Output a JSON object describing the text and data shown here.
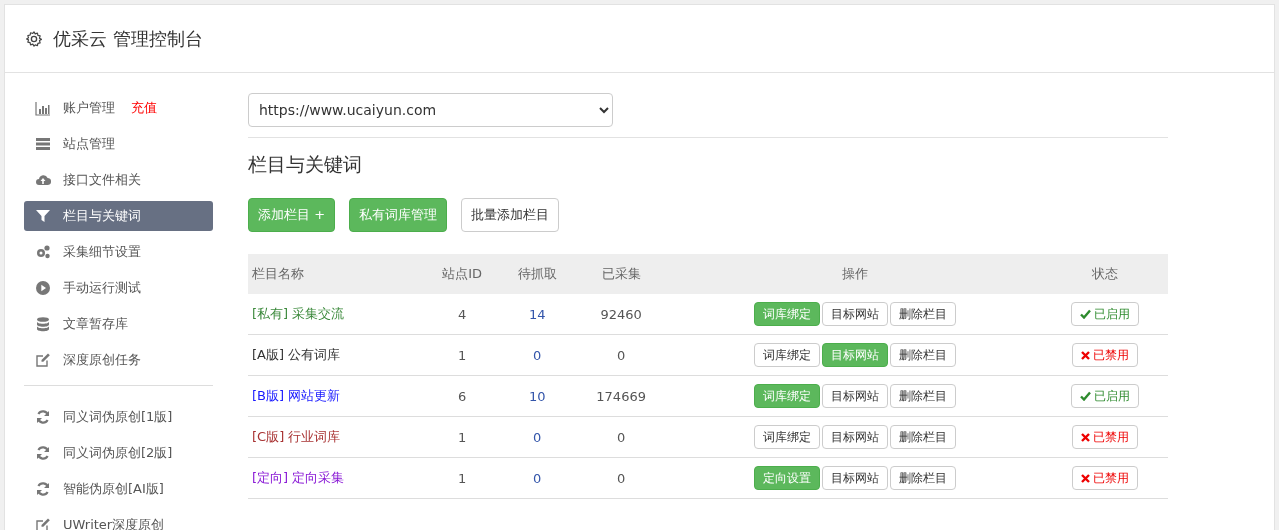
{
  "header": {
    "title": "优采云 管理控制台"
  },
  "sidebar": {
    "groups": [
      [
        {
          "kind": "chart",
          "label": "账户管理",
          "link": "充值",
          "selected": false
        },
        {
          "kind": "server",
          "label": "站点管理",
          "selected": false
        },
        {
          "kind": "cloud",
          "label": "接口文件相关",
          "selected": false
        },
        {
          "kind": "filter",
          "label": "栏目与关键词",
          "selected": true
        },
        {
          "kind": "gears",
          "label": "采集细节设置",
          "selected": false
        },
        {
          "kind": "play",
          "label": "手动运行测试",
          "selected": false
        },
        {
          "kind": "database",
          "label": "文章暂存库",
          "selected": false
        },
        {
          "kind": "edit",
          "label": "深度原创任务",
          "selected": false
        }
      ],
      [
        {
          "kind": "refresh",
          "label": "同义词伪原创[1版]",
          "selected": false
        },
        {
          "kind": "refresh",
          "label": "同义词伪原创[2版]",
          "selected": false
        },
        {
          "kind": "refresh",
          "label": "智能伪原创[AI版]",
          "selected": false
        },
        {
          "kind": "edit",
          "label": "UWriter深度原创",
          "selected": false
        }
      ]
    ]
  },
  "site_select": {
    "value": "https://www.ucaiyun.com"
  },
  "section_title": "栏目与关键词",
  "toolbar": [
    {
      "label": "添加栏目 +",
      "primary": true
    },
    {
      "label": "私有词库管理",
      "primary": true
    },
    {
      "label": "批量添加栏目",
      "primary": false
    }
  ],
  "table": {
    "columns": [
      "栏目名称",
      "站点ID",
      "待抓取",
      "已采集",
      "操作",
      "状态"
    ],
    "rows": [
      {
        "tag": "[私有]",
        "name": "采集交流",
        "color": "#3c8a3c",
        "site_id": "4",
        "pending": "14",
        "collected": "92460",
        "actions": [
          {
            "label": "词库绑定",
            "primary": true
          },
          {
            "label": "目标网站",
            "primary": false
          },
          {
            "label": "删除栏目",
            "primary": false
          }
        ],
        "status": "已启用",
        "enabled": true
      },
      {
        "tag": "[A版]",
        "name": "公有词库",
        "color": "#333333",
        "site_id": "1",
        "pending": "0",
        "collected": "0",
        "actions": [
          {
            "label": "词库绑定",
            "primary": false
          },
          {
            "label": "目标网站",
            "primary": true
          },
          {
            "label": "删除栏目",
            "primary": false
          }
        ],
        "status": "已禁用",
        "enabled": false
      },
      {
        "tag": "[B版]",
        "name": "网站更新",
        "color": "#1a1aff",
        "site_id": "6",
        "pending": "10",
        "collected": "174669",
        "actions": [
          {
            "label": "词库绑定",
            "primary": true
          },
          {
            "label": "目标网站",
            "primary": false
          },
          {
            "label": "删除栏目",
            "primary": false
          }
        ],
        "status": "已启用",
        "enabled": true
      },
      {
        "tag": "[C版]",
        "name": "行业词库",
        "color": "#a83232",
        "site_id": "1",
        "pending": "0",
        "collected": "0",
        "actions": [
          {
            "label": "词库绑定",
            "primary": false
          },
          {
            "label": "目标网站",
            "primary": false
          },
          {
            "label": "删除栏目",
            "primary": false
          }
        ],
        "status": "已禁用",
        "enabled": false
      },
      {
        "tag": "[定向]",
        "name": "定向采集",
        "color": "#8a1ad6",
        "site_id": "1",
        "pending": "0",
        "collected": "0",
        "actions": [
          {
            "label": "定向设置",
            "primary": true
          },
          {
            "label": "目标网站",
            "primary": false
          },
          {
            "label": "删除栏目",
            "primary": false
          }
        ],
        "status": "已禁用",
        "enabled": false
      }
    ]
  }
}
